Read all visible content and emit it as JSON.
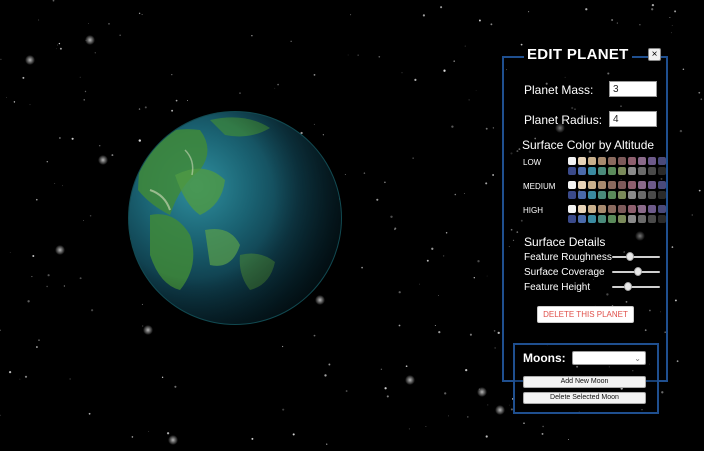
{
  "panel": {
    "title": "EDIT PLANET",
    "close_label": "×",
    "mass_label": "Planet Mass:",
    "mass_value": "3",
    "radius_label": "Planet Radius:",
    "radius_value": "4",
    "surface_color_title": "Surface Color by Altitude",
    "altitudes": [
      {
        "label": "LOW"
      },
      {
        "label": "MEDIUM"
      },
      {
        "label": "HIGH"
      }
    ],
    "palette": [
      "#f4f4f4",
      "#e8d4b8",
      "#c9b08c",
      "#a78a6e",
      "#8a6a5e",
      "#7d5a5a",
      "#8e5f6e",
      "#8a6a8a",
      "#6d5a8a",
      "#4a4a7a",
      "#3a4a8a",
      "#4a6aaa",
      "#3a8aa0",
      "#4a8a7a",
      "#5a8a5a",
      "#7a8a5a",
      "#8a8a8a",
      "#6a6a6a",
      "#4a4a4a",
      "#2a2a2a"
    ],
    "details_title": "Surface Details",
    "sliders": [
      {
        "label": "Feature Roughness",
        "value": 0.35
      },
      {
        "label": "Surface Coverage",
        "value": 0.55
      },
      {
        "label": "Feature Height",
        "value": 0.3
      }
    ],
    "delete_label": "DELETE THIS PLANET"
  },
  "moons": {
    "label": "Moons:",
    "selected": "",
    "add_label": "Add New Moon",
    "delete_label": "Delete Selected Moon"
  },
  "colors": {
    "panel_border": "#1f4f8f",
    "delete_text": "#e0504a",
    "ocean": "#123a4a",
    "land": "#3f8a3a"
  }
}
